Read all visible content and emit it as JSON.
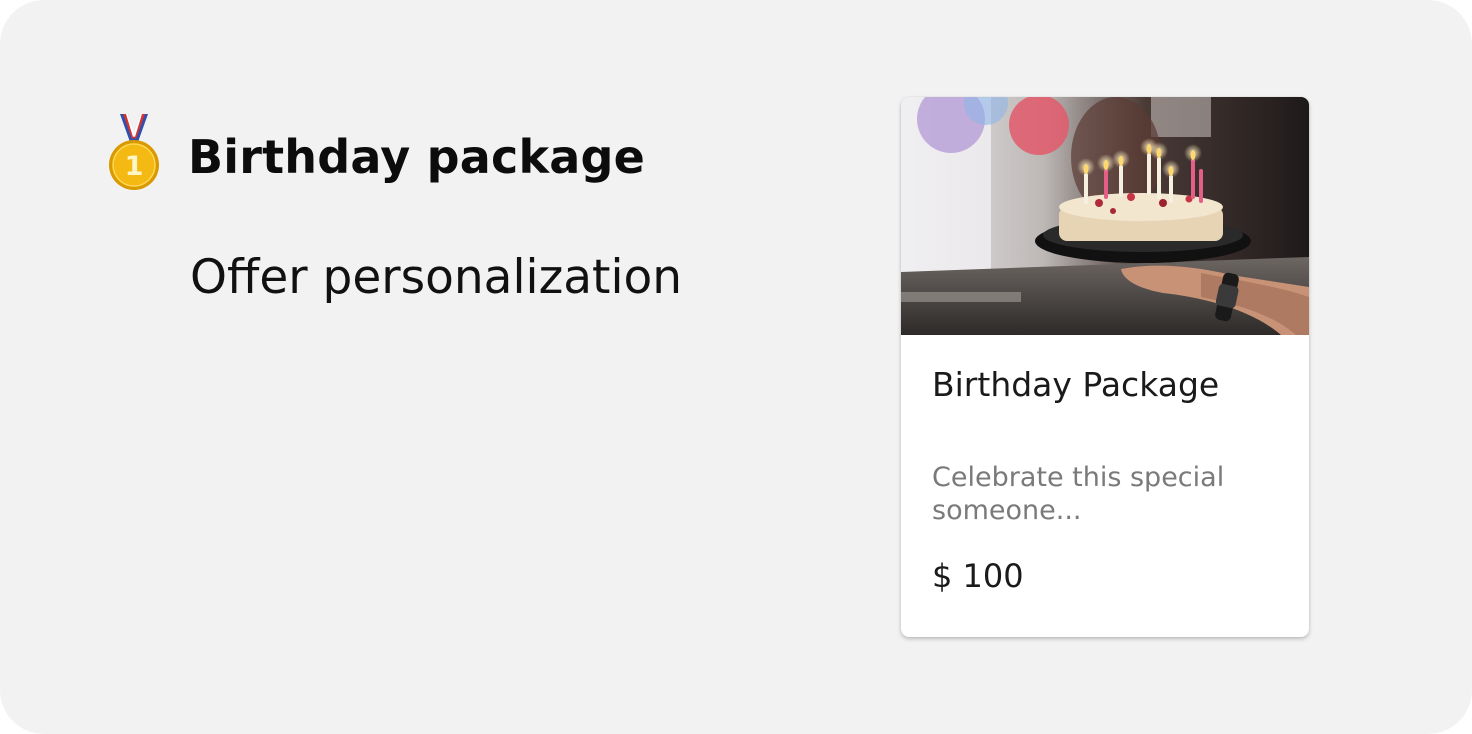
{
  "headline": {
    "title": "Birthday package",
    "medal_icon": "first-place-medal-icon",
    "medal_number": "1"
  },
  "subtitle": "Offer personalization",
  "card": {
    "image_icon": "birthday-cake-photo",
    "name": "Birthday Package",
    "description": "Celebrate this special someone...",
    "price": "$ 100"
  },
  "colors": {
    "background": "#f2f2f2",
    "card": "#ffffff",
    "description_text": "#7a7a7a",
    "medal_gold": "#e8a800"
  }
}
